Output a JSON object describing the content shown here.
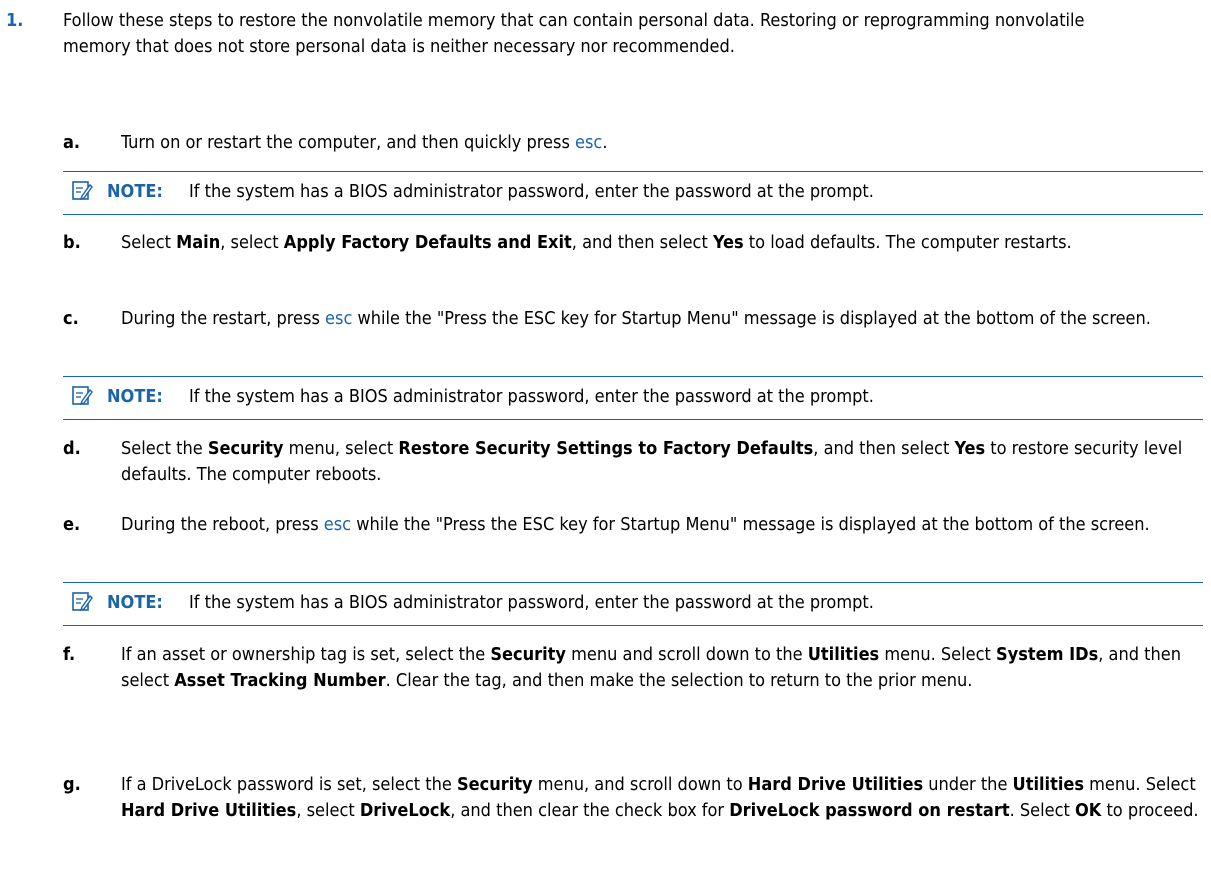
{
  "step1": {
    "number": "1.",
    "text": "Follow these steps to restore the nonvolatile memory that can contain personal data. Restoring or reprogramming nonvolatile memory that does not store personal data is neither necessary nor recommended."
  },
  "note": {
    "label": "NOTE:",
    "text": "If the system has a BIOS administrator password, enter the password at the prompt."
  },
  "substeps": {
    "a": {
      "letter": "a.",
      "t1": "Turn on or restart the computer, and then quickly press ",
      "key": "esc",
      "t2": "."
    },
    "b": {
      "letter": "b.",
      "t1": "Select ",
      "b1": "Main",
      "t2": ", select ",
      "b2": "Apply Factory Defaults and Exit",
      "t3": ", and then select ",
      "b3": "Yes",
      "t4": " to load defaults. The computer restarts."
    },
    "c": {
      "letter": "c.",
      "t1": "During the restart, press ",
      "key": "esc",
      "t2": " while the \"Press the ESC key for Startup Menu\" message is displayed at the bottom of the screen."
    },
    "d": {
      "letter": "d.",
      "t1": "Select the ",
      "b1": "Security",
      "t2": " menu, select ",
      "b2": "Restore Security Settings to Factory Defaults",
      "t3": ", and then select ",
      "b3": "Yes",
      "t4": " to restore security level defaults. The computer reboots."
    },
    "e": {
      "letter": "e.",
      "t1": "During the reboot, press ",
      "key": "esc",
      "t2": " while the \"Press the ESC key for Startup Menu\" message is displayed at the bottom of the screen."
    },
    "f": {
      "letter": "f.",
      "t1": "If an asset or ownership tag is set, select the ",
      "b1": "Security",
      "t2": " menu and scroll down to the ",
      "b2": "Utilities",
      "t3": " menu. Select ",
      "b3": "System IDs",
      "t4": ", and then select ",
      "b4": "Asset Tracking Number",
      "t5": ". Clear the tag, and then make the selection to return to the prior menu."
    },
    "g": {
      "letter": "g.",
      "t1": "If a DriveLock password is set, select the ",
      "b1": "Security",
      "t2": " menu, and scroll down to ",
      "b2": "Hard Drive Utilities",
      "t3": " under the ",
      "b3": "Utilities",
      "t4": " menu. Select ",
      "b4": "Hard Drive Utilities",
      "t5": ", select ",
      "b5": "DriveLock",
      "t6": ", and then clear the check box for ",
      "b6": "DriveLock password on restart",
      "t7": ". Select ",
      "b7": "OK",
      "t8": " to proceed."
    }
  }
}
